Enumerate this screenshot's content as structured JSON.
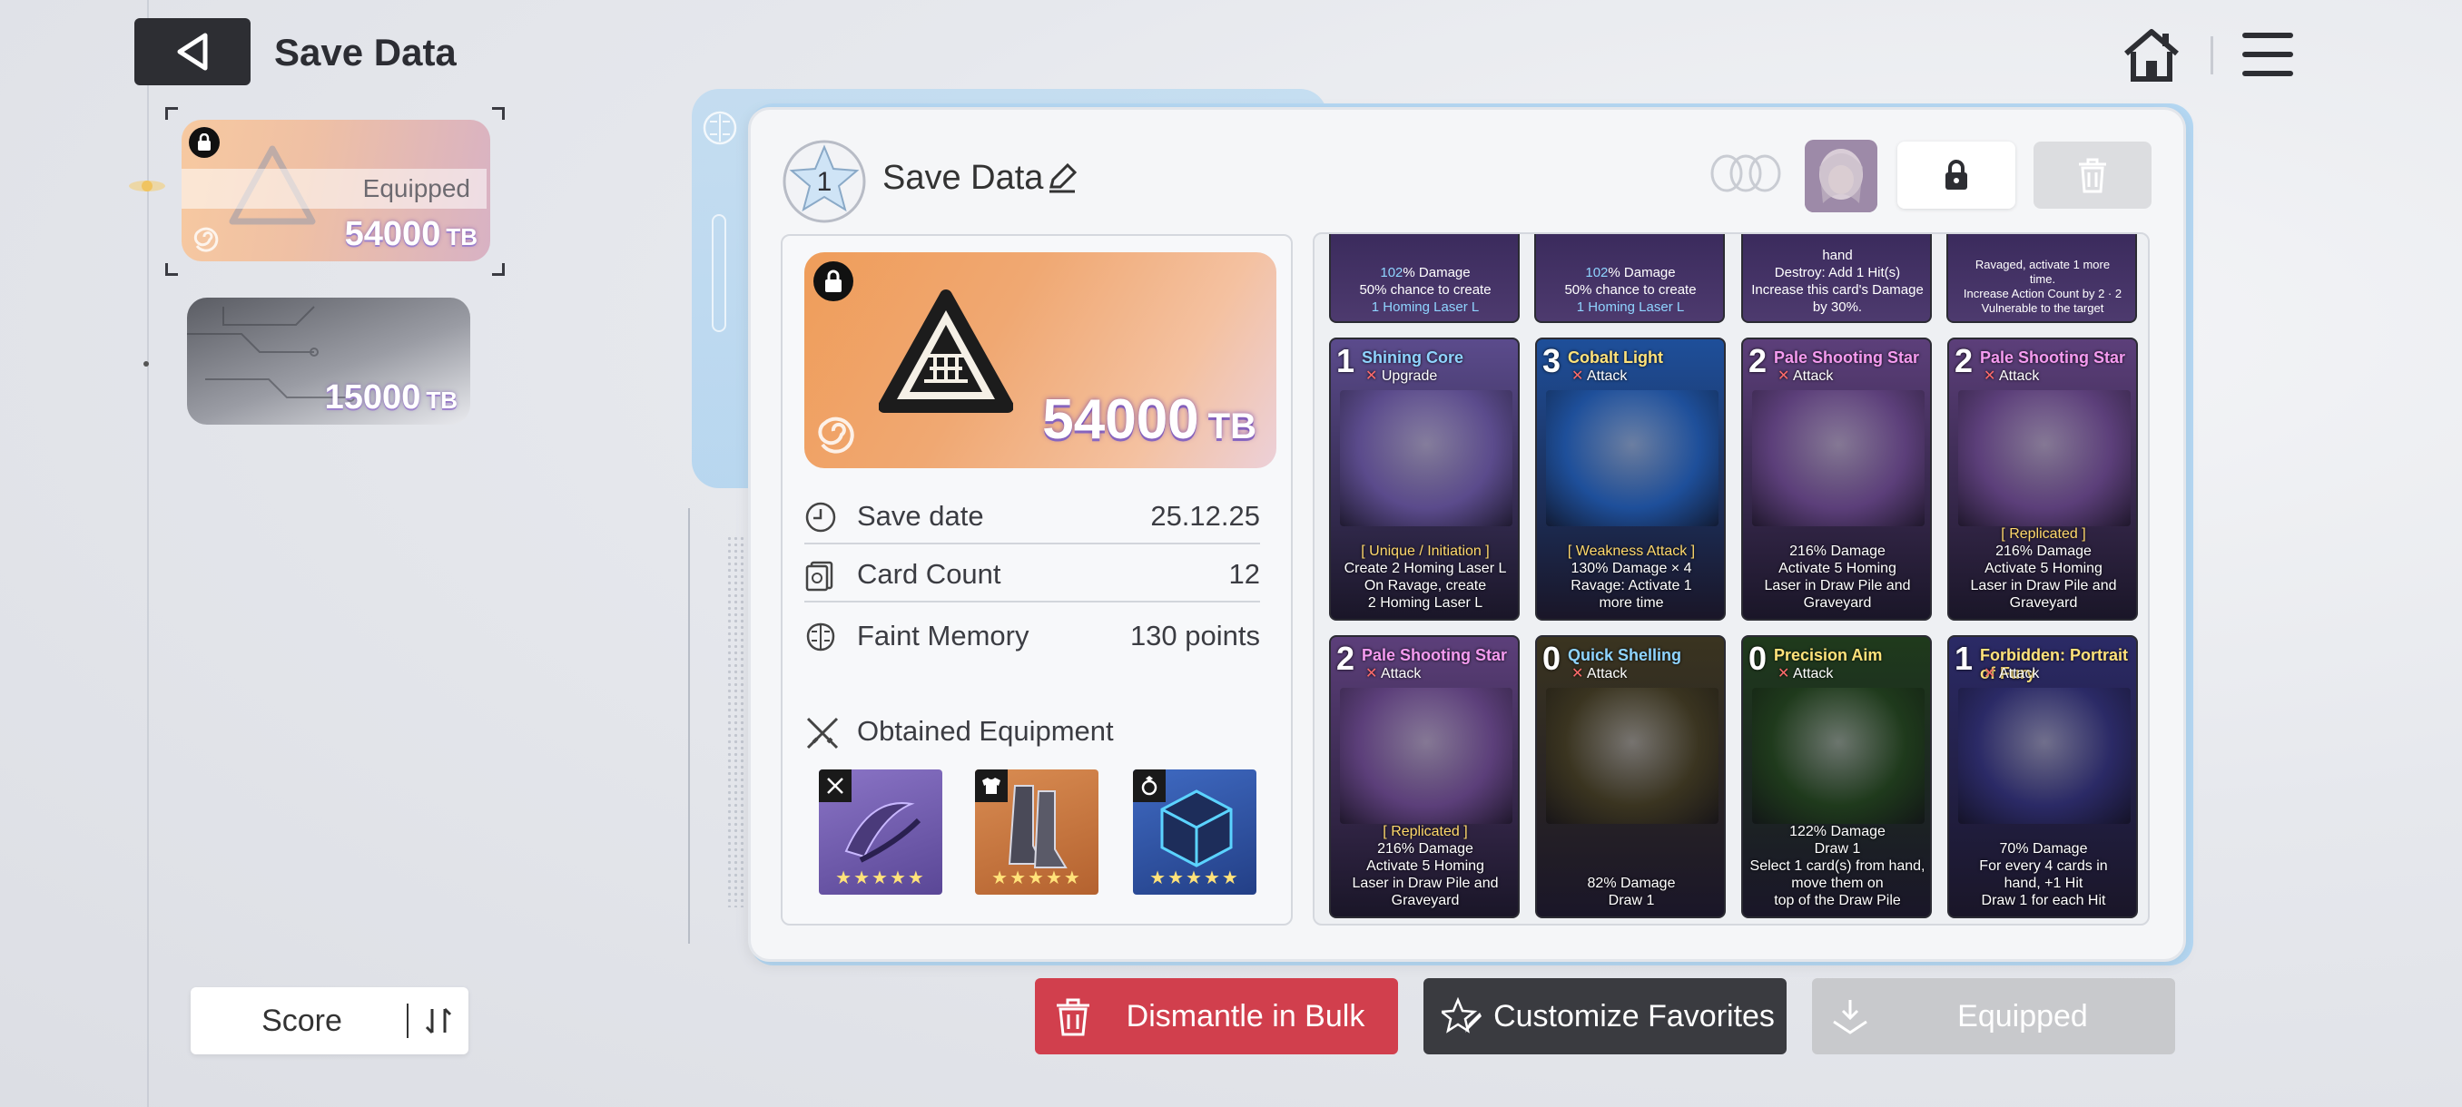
{
  "header": {
    "title": "Save Data"
  },
  "sidebar": {
    "slots": [
      {
        "tb": "54000",
        "unit": "TB",
        "status": "Equipped",
        "locked": true
      },
      {
        "tb": "15000",
        "unit": "TB"
      }
    ],
    "sort_label": "Score"
  },
  "panel": {
    "rank": "1",
    "title": "Save Data",
    "hero": {
      "tb": "54000",
      "unit": "TB"
    },
    "stats": [
      {
        "label": "Save date",
        "value": "25.12.25"
      },
      {
        "label": "Card Count",
        "value": "12"
      },
      {
        "label": "Faint Memory",
        "value": "130 points"
      }
    ],
    "equipment_title": "Obtained Equipment",
    "equipment": [
      {
        "type": "weapon",
        "stars": "★★★★★",
        "color": "#6f5aa8"
      },
      {
        "type": "armor",
        "stars": "★★★★★",
        "color": "#c7733e"
      },
      {
        "type": "accessory",
        "stars": "★★★★★",
        "color": "#2f4f93"
      }
    ]
  },
  "top_cards": [
    {
      "l1a": "102",
      "l1b": "% Damage",
      "l2": "50% chance to create",
      "l3": "1 Homing Laser L"
    },
    {
      "l1a": "102",
      "l1b": "% Damage",
      "l2": "50% chance to create",
      "l3": "1 Homing Laser L"
    },
    {
      "l1a": "hand",
      "l1b": "",
      "l2": "Destroy: Add 1 Hit(s)",
      "l3": "Increase this card's Damage by 30%."
    },
    {
      "l1a": "Ravaged, activate 1 more",
      "l1b": "",
      "l2": "time.",
      "l3": "Increase Action Count by 2 · 2 Vulnerable to the target"
    }
  ],
  "cards": [
    {
      "cost": "1",
      "name": "Shining Core",
      "type": "Upgrade",
      "name_color": "#8fd4ff",
      "desc": [
        "[ Unique / Initiation ]",
        "Create 2 Homing Laser L",
        "On Ravage, create",
        "2 Homing Laser L"
      ],
      "bg": "#5b4b8c"
    },
    {
      "cost": "3",
      "name": "Cobalt Light",
      "type": "Attack",
      "name_color": "#ffe27a",
      "desc": [
        "[ Weakness Attack ]",
        "130% Damage × 4",
        "Ravage: Activate 1",
        "more time"
      ],
      "bg": "#1e4f9a"
    },
    {
      "cost": "2",
      "name": "Pale Shooting Star",
      "type": "Attack",
      "name_color": "#f59bf0",
      "desc": [
        "216% Damage",
        "Activate 5 Homing",
        "Laser in Draw Pile and",
        "Graveyard"
      ],
      "bg": "#5c3f7a"
    },
    {
      "cost": "2",
      "name": "Pale Shooting Star",
      "type": "Attack",
      "name_color": "#f59bf0",
      "desc": [
        "[ Replicated ]",
        "216% Damage",
        "Activate 5 Homing",
        "Laser in Draw Pile and Graveyard"
      ],
      "bg": "#5c3f7a"
    },
    {
      "cost": "2",
      "name": "Pale Shooting Star",
      "type": "Attack",
      "name_color": "#f59bf0",
      "desc": [
        "[ Replicated ]",
        "216% Damage",
        "Activate 5 Homing",
        "Laser in Draw Pile and Graveyard"
      ],
      "bg": "#5c3f7a"
    },
    {
      "cost": "0",
      "name": "Quick Shelling",
      "type": "Attack",
      "name_color": "#8fd4ff",
      "desc": [
        "82% Damage",
        "Draw 1"
      ],
      "bg": "#3a3420"
    },
    {
      "cost": "0",
      "name": "Precision Aim",
      "type": "Attack",
      "name_color": "#ffe27a",
      "desc": [
        "122% Damage",
        "Draw 1",
        "Select 1 card(s) from hand, move them on",
        "top of the Draw Pile"
      ],
      "bg": "#1f3a1c"
    },
    {
      "cost": "1",
      "name": "Forbidden: Portrait of Fury",
      "type": "Attack",
      "name_color": "#ffe27a",
      "desc": [
        "70% Damage",
        "For every 4 cards in",
        "hand, +1 Hit",
        "Draw 1 for each Hit"
      ],
      "bg": "#2b2a66"
    }
  ],
  "buttons": {
    "dismantle": "Dismantle in Bulk",
    "favorites": "Customize Favorites",
    "equipped": "Equipped"
  },
  "colors": {
    "accent_red": "#d13f4d",
    "dark_btn": "#3a3b40",
    "disabled_btn": "#c8c9cc",
    "panel_glow": "#b5d8f3"
  }
}
